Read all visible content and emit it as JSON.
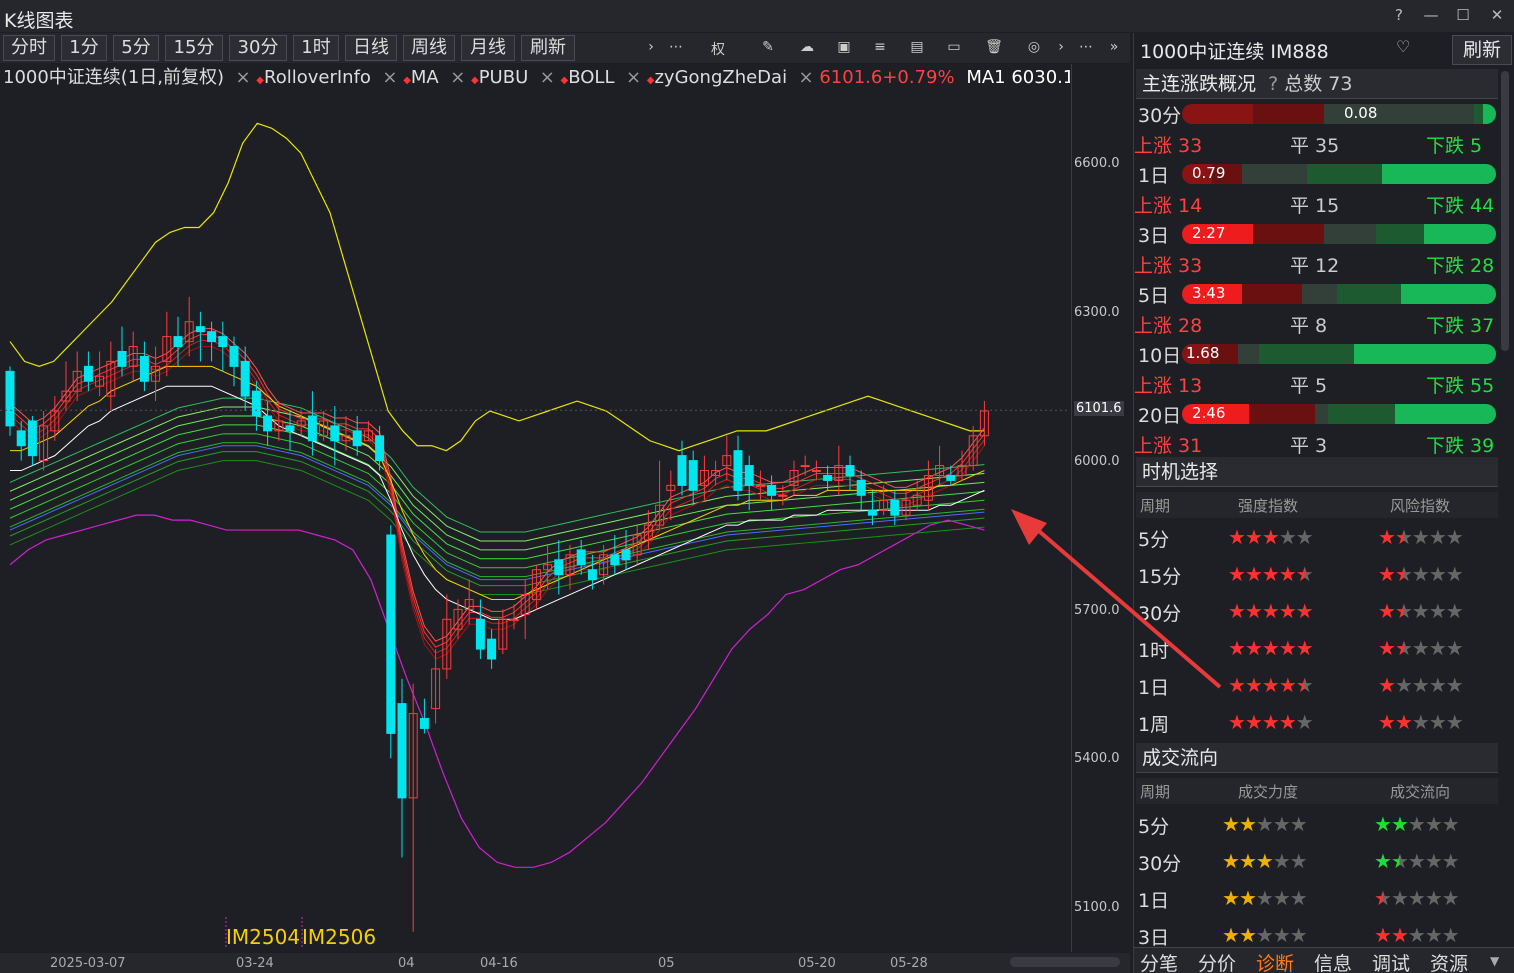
{
  "window": {
    "title": "K线图表"
  },
  "toolbar": {
    "periods": [
      "分时",
      "1分",
      "5分",
      "15分",
      "30分",
      "1时",
      "日线",
      "周线",
      "月线",
      "刷新"
    ],
    "weight_label": "权"
  },
  "legend": {
    "instrument": "1000中证连续(1日,前复权)",
    "indicators": [
      "RolloverInfo",
      "MA",
      "PUBU",
      "BOLL",
      "zyGongZheDai"
    ],
    "price_change": "6101.6+0.79%",
    "ma_label": "MA1 6030.1"
  },
  "y_axis": {
    "labels": [
      "6600.0",
      "6300.0",
      "6101.6",
      "6000.0",
      "5700.0",
      "5400.0",
      "5100.0"
    ]
  },
  "x_axis": {
    "labels": [
      "2025-03-07",
      "03-24",
      "04",
      "04-16",
      "05",
      "05-20",
      "05-28"
    ]
  },
  "contracts": [
    "IM2504",
    "IM2506"
  ],
  "chart_data": {
    "type": "candlestick",
    "ylim": [
      5050,
      6700
    ],
    "last_price": 6101.6,
    "candles": [
      [
        6180,
        6070,
        6190,
        6050
      ],
      [
        6060,
        6030,
        6080,
        6000
      ],
      [
        6080,
        6010,
        6090,
        5990
      ],
      [
        6000,
        6070,
        6100,
        5980
      ],
      [
        6060,
        6100,
        6130,
        6040
      ],
      [
        6120,
        6140,
        6200,
        6100
      ],
      [
        6140,
        6180,
        6220,
        6120
      ],
      [
        6190,
        6160,
        6220,
        6140
      ],
      [
        6150,
        6170,
        6220,
        6130
      ],
      [
        6130,
        6200,
        6240,
        6100
      ],
      [
        6220,
        6190,
        6270,
        6170
      ],
      [
        6190,
        6230,
        6260,
        6160
      ],
      [
        6210,
        6160,
        6240,
        6140
      ],
      [
        6160,
        6190,
        6230,
        6120
      ],
      [
        6200,
        6250,
        6300,
        6170
      ],
      [
        6250,
        6230,
        6290,
        6190
      ],
      [
        6240,
        6280,
        6330,
        6210
      ],
      [
        6270,
        6260,
        6300,
        6200
      ],
      [
        6260,
        6240,
        6280,
        6200
      ],
      [
        6250,
        6230,
        6280,
        6180
      ],
      [
        6230,
        6190,
        6250,
        6150
      ],
      [
        6200,
        6130,
        6230,
        6100
      ],
      [
        6140,
        6090,
        6160,
        6060
      ],
      [
        6090,
        6060,
        6120,
        6030
      ],
      [
        6060,
        6080,
        6120,
        6040
      ],
      [
        6070,
        6060,
        6100,
        6020
      ],
      [
        6070,
        6080,
        6100,
        6050
      ],
      [
        6090,
        6040,
        6140,
        6010
      ],
      [
        6050,
        6080,
        6100,
        6040
      ],
      [
        6070,
        6040,
        6110,
        5990
      ],
      [
        6040,
        6050,
        6090,
        6020
      ],
      [
        6060,
        6030,
        6090,
        6010
      ],
      [
        6040,
        6060,
        6080,
        6040
      ],
      [
        6050,
        6000,
        6070,
        5980
      ],
      [
        5850,
        5450,
        5870,
        5400
      ],
      [
        5510,
        5320,
        5560,
        5200
      ],
      [
        5320,
        5490,
        5550,
        5050
      ],
      [
        5480,
        5460,
        5520,
        5450
      ],
      [
        5500,
        5580,
        5620,
        5470
      ],
      [
        5580,
        5680,
        5730,
        5560
      ],
      [
        5660,
        5700,
        5720,
        5640
      ],
      [
        5700,
        5720,
        5760,
        5670
      ],
      [
        5680,
        5620,
        5720,
        5600
      ],
      [
        5640,
        5600,
        5660,
        5580
      ],
      [
        5620,
        5680,
        5700,
        5610
      ],
      [
        5680,
        5680,
        5710,
        5660
      ],
      [
        5690,
        5730,
        5760,
        5640
      ],
      [
        5720,
        5780,
        5790,
        5700
      ],
      [
        5780,
        5790,
        5830,
        5740
      ],
      [
        5800,
        5770,
        5840,
        5730
      ],
      [
        5770,
        5810,
        5830,
        5740
      ],
      [
        5820,
        5790,
        5840,
        5770
      ],
      [
        5780,
        5760,
        5810,
        5740
      ],
      [
        5770,
        5810,
        5830,
        5750
      ],
      [
        5810,
        5790,
        5850,
        5770
      ],
      [
        5820,
        5800,
        5860,
        5780
      ],
      [
        5810,
        5850,
        5870,
        5790
      ],
      [
        5840,
        5870,
        5900,
        5820
      ],
      [
        5870,
        5910,
        6000,
        5860
      ],
      [
        5940,
        5950,
        5980,
        5880
      ],
      [
        6010,
        5950,
        6040,
        5930
      ],
      [
        6000,
        5940,
        6020,
        5910
      ],
      [
        5950,
        5980,
        6010,
        5920
      ],
      [
        5970,
        5980,
        6000,
        5950
      ],
      [
        5990,
        6010,
        6050,
        5960
      ],
      [
        6020,
        5940,
        6050,
        5920
      ],
      [
        5990,
        5950,
        6010,
        5900
      ],
      [
        5950,
        5950,
        5980,
        5920
      ],
      [
        5950,
        5930,
        5970,
        5900
      ],
      [
        5930,
        5930,
        5950,
        5910
      ],
      [
        5950,
        5980,
        6000,
        5930
      ],
      [
        5990,
        5990,
        6010,
        5970
      ],
      [
        5980,
        5980,
        6000,
        5960
      ],
      [
        5970,
        5960,
        5990,
        5940
      ],
      [
        5960,
        5990,
        6030,
        5930
      ],
      [
        5990,
        5970,
        6010,
        5940
      ],
      [
        5960,
        5930,
        5980,
        5900
      ],
      [
        5900,
        5890,
        5940,
        5870
      ],
      [
        5900,
        5920,
        5950,
        5890
      ],
      [
        5920,
        5890,
        5940,
        5870
      ],
      [
        5890,
        5920,
        5940,
        5880
      ],
      [
        5910,
        5930,
        5960,
        5900
      ],
      [
        5920,
        5970,
        6000,
        5900
      ],
      [
        5970,
        5990,
        6030,
        5950
      ],
      [
        5970,
        5960,
        5990,
        5950
      ],
      [
        5970,
        5990,
        6020,
        5960
      ],
      [
        5990,
        6050,
        6070,
        5980
      ],
      [
        6050,
        6100,
        6120,
        6030
      ]
    ],
    "boll_upper": [
      6240,
      6200,
      6190,
      6200,
      6230,
      6260,
      6290,
      6320,
      6360,
      6400,
      6440,
      6460,
      6470,
      6470,
      6500,
      6560,
      6640,
      6680,
      6670,
      6650,
      6620,
      6560,
      6500,
      6400,
      6300,
      6200,
      6100,
      6060,
      6030,
      6030,
      6020,
      6040,
      6080,
      6100,
      6090,
      6080,
      6090,
      6100,
      6110,
      6120,
      6110,
      6100,
      6080,
      6060,
      6040,
      6030,
      6020,
      6030,
      6040,
      6050,
      6060,
      6060,
      6060,
      6070,
      6080,
      6090,
      6100,
      6110,
      6120,
      6130,
      6120,
      6110,
      6100,
      6090,
      6080,
      6070,
      6060,
      6060
    ],
    "boll_lower": [
      5850,
      5880,
      5900,
      5910,
      5920,
      5930,
      5940,
      5950,
      5950,
      5940,
      5940,
      5930,
      5920,
      5920,
      5920,
      5920,
      5920,
      5910,
      5900,
      5880,
      5820,
      5720,
      5620,
      5530,
      5430,
      5340,
      5280,
      5250,
      5240,
      5240,
      5250,
      5270,
      5300,
      5330,
      5370,
      5410,
      5460,
      5510,
      5560,
      5620,
      5680,
      5720,
      5750,
      5790,
      5800,
      5820,
      5840,
      5850,
      5870,
      5890,
      5910,
      5930,
      5940,
      5930,
      5920
    ],
    "ma_fast": [
      6100,
      6080,
      6060,
      6070,
      6090,
      6120,
      6150,
      6160,
      6170,
      6180,
      6190,
      6200,
      6200,
      6190,
      6200,
      6220,
      6240,
      6250,
      6250,
      6240,
      6220,
      6200,
      6170,
      6130,
      6100,
      6090,
      6080,
      6080,
      6080,
      6070,
      6070,
      6060,
      6060,
      6040,
      5950,
      5820,
      5720,
      5650,
      5620,
      5630,
      5660,
      5690,
      5690,
      5680,
      5680,
      5690,
      5710,
      5730,
      5760,
      5780,
      5790,
      5800,
      5800,
      5800,
      5810,
      5820,
      5830,
      5850,
      5880,
      5910,
      5920,
      5930,
      5940,
      5960,
      5970,
      5960,
      5960,
      5950,
      5940,
      5940,
      5950,
      5960,
      5970,
      5970,
      5970,
      5970,
      5960,
      5950,
      5940,
      5930,
      5930,
      5940,
      5950,
      5960,
      5970,
      5990,
      6020,
      6050
    ],
    "ma_mid": [
      6020,
      6020,
      6030,
      6040,
      6050,
      6070,
      6090,
      6110,
      6120,
      6140,
      6150,
      6160,
      6170,
      6180,
      6190,
      6190,
      6190,
      6190,
      6190,
      6180,
      6170,
      6160,
      6150,
      6130,
      6110,
      6100,
      6090,
      6080,
      6070,
      6060,
      6050,
      6040,
      6030,
      6010,
      5960,
      5900,
      5850,
      5810,
      5780,
      5760,
      5750,
      5740,
      5730,
      5720,
      5720,
      5720,
      5730,
      5740,
      5750,
      5760,
      5770,
      5780,
      5790,
      5800,
      5810,
      5820,
      5830,
      5840,
      5850,
      5860,
      5870,
      5880,
      5890,
      5900,
      5910,
      5910,
      5920,
      5920,
      5920,
      5920,
      5930,
      5930,
      5930,
      5940,
      5940,
      5940,
      5940,
      5940,
      5940,
      5940,
      5940,
      5940,
      5940,
      5950,
      5950,
      5960,
      5970,
      5980
    ],
    "ma_slow": [
      5920,
      5930,
      5940,
      5950,
      5960,
      5970,
      5980,
      5990,
      6000,
      6010,
      6020,
      6030,
      6040,
      6050,
      6060,
      6070,
      6075,
      6080,
      6085,
      6090,
      6090,
      6090,
      6090,
      6085,
      6080,
      6075,
      6070,
      6060,
      6050,
      6040,
      6030,
      6020,
      6010,
      5990,
      5970,
      5940,
      5910,
      5890,
      5870,
      5850,
      5840,
      5830,
      5820,
      5820,
      5820,
      5820,
      5820,
      5825,
      5830,
      5835,
      5840,
      5845,
      5850,
      5855,
      5860,
      5865,
      5870,
      5875,
      5880,
      5885,
      5890,
      5895,
      5900,
      5905,
      5910,
      5912,
      5914,
      5916,
      5918,
      5920,
      5922,
      5924,
      5926,
      5928,
      5930,
      5932,
      5934,
      5936,
      5938,
      5940,
      5942,
      5944,
      5946,
      5948,
      5950,
      5952,
      5954,
      5956
    ]
  },
  "right_panel": {
    "symbol": "1000中证连续 IM888",
    "refresh_label": "刷新",
    "summary_title": "主连涨跌概况",
    "total_label": "总数 73",
    "rows": [
      {
        "period": "30分",
        "value": "0.08",
        "up": "上涨 33",
        "flat": "平 35",
        "down": "下跌 5"
      },
      {
        "period": "1日",
        "value": "0.79",
        "up": "上涨 14",
        "flat": "平 15",
        "down": "下跌 44"
      },
      {
        "period": "3日",
        "value": "2.27",
        "up": "上涨 33",
        "flat": "平 12",
        "down": "下跌 28"
      },
      {
        "period": "5日",
        "value": "3.43",
        "up": "上涨 28",
        "flat": "平 8",
        "down": "下跌 37"
      },
      {
        "period": "10日",
        "value": "1.68",
        "up": "上涨 13",
        "flat": "平 5",
        "down": "下跌 55"
      },
      {
        "period": "20日",
        "value": "2.46",
        "up": "上涨 31",
        "flat": "平 3",
        "down": "下跌 39"
      }
    ],
    "timing_title": "时机选择",
    "timing_headers": [
      "周期",
      "强度指数",
      "风险指数"
    ],
    "timing_rows": [
      {
        "period": "5分",
        "strength": 3,
        "risk": 1.5
      },
      {
        "period": "15分",
        "strength": 4.5,
        "risk": 1.5
      },
      {
        "period": "30分",
        "strength": 5,
        "risk": 1.5
      },
      {
        "period": "1时",
        "strength": 5,
        "risk": 1.5
      },
      {
        "period": "1日",
        "strength": 4.5,
        "risk": 1
      },
      {
        "period": "1周",
        "strength": 4,
        "risk": 2
      }
    ],
    "flow_title": "成交流向",
    "flow_headers": [
      "周期",
      "成交力度",
      "成交流向"
    ],
    "flow_rows": [
      {
        "period": "5分",
        "force": 2,
        "dir": 2
      },
      {
        "period": "30分",
        "force": 3,
        "dir": 1.5
      },
      {
        "period": "1日",
        "force": 2,
        "dir": 0.5
      },
      {
        "period": "3日",
        "force": 2,
        "dir": 2
      }
    ],
    "bottom_tabs": [
      "分笔",
      "分价",
      "诊断",
      "信息",
      "调试",
      "资源"
    ],
    "active_tab": "诊断"
  }
}
